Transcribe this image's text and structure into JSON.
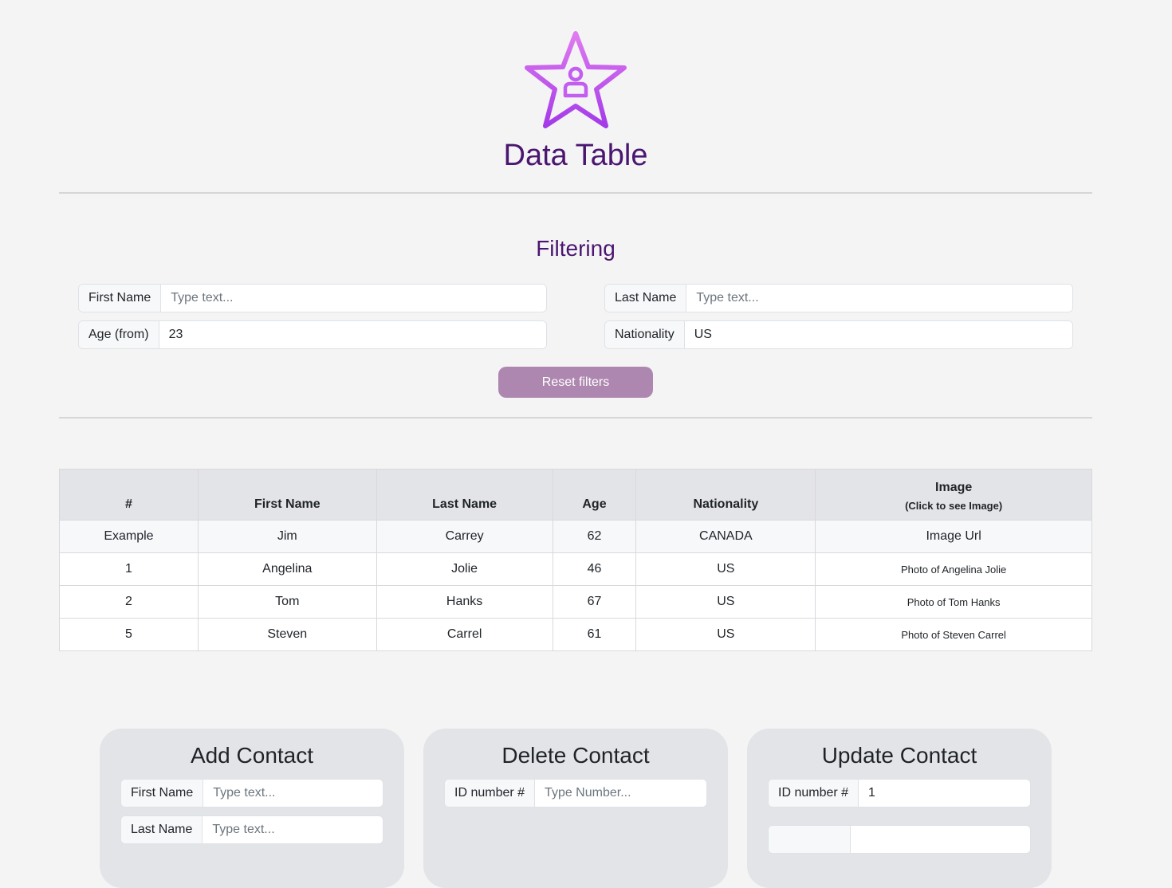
{
  "header": {
    "title": "Data Table",
    "logo_icon": "star-user-icon",
    "accent": "#4a1670",
    "logo_gradient": [
      "#e07cf0",
      "#a43ae8"
    ]
  },
  "filtering": {
    "title": "Filtering",
    "first_name": {
      "label": "First Name",
      "value": "",
      "placeholder": "Type text..."
    },
    "last_name": {
      "label": "Last Name",
      "value": "",
      "placeholder": "Type text..."
    },
    "age_from": {
      "label": "Age (from)",
      "value": "23",
      "placeholder": ""
    },
    "nationality": {
      "label": "Nationality",
      "value": "US",
      "placeholder": ""
    },
    "reset_label": "Reset filters",
    "reset_color": "#ae87b0"
  },
  "table": {
    "headers": {
      "num": "#",
      "first_name": "First Name",
      "last_name": "Last Name",
      "age": "Age",
      "nationality": "Nationality",
      "image": "Image",
      "image_sub": "(Click to see Image)"
    },
    "example": {
      "num": "Example",
      "first_name": "Jim",
      "last_name": "Carrey",
      "age": "62",
      "nationality": "CANADA",
      "image": "Image Url"
    },
    "rows": [
      {
        "num": "1",
        "first_name": "Angelina",
        "last_name": "Jolie",
        "age": "46",
        "nationality": "US",
        "image": "Photo of Angelina Jolie"
      },
      {
        "num": "2",
        "first_name": "Tom",
        "last_name": "Hanks",
        "age": "67",
        "nationality": "US",
        "image": "Photo of Tom Hanks"
      },
      {
        "num": "5",
        "first_name": "Steven",
        "last_name": "Carrel",
        "age": "61",
        "nationality": "US",
        "image": "Photo of Steven Carrel"
      }
    ]
  },
  "add_contact": {
    "title": "Add Contact",
    "first_name": {
      "label": "First Name",
      "value": "",
      "placeholder": "Type text..."
    },
    "last_name": {
      "label": "Last Name",
      "value": "",
      "placeholder": "Type text..."
    }
  },
  "delete_contact": {
    "title": "Delete Contact",
    "id": {
      "label": "ID number #",
      "value": "",
      "placeholder": "Type Number..."
    }
  },
  "update_contact": {
    "title": "Update Contact",
    "id": {
      "label": "ID number #",
      "value": "1",
      "placeholder": ""
    }
  }
}
